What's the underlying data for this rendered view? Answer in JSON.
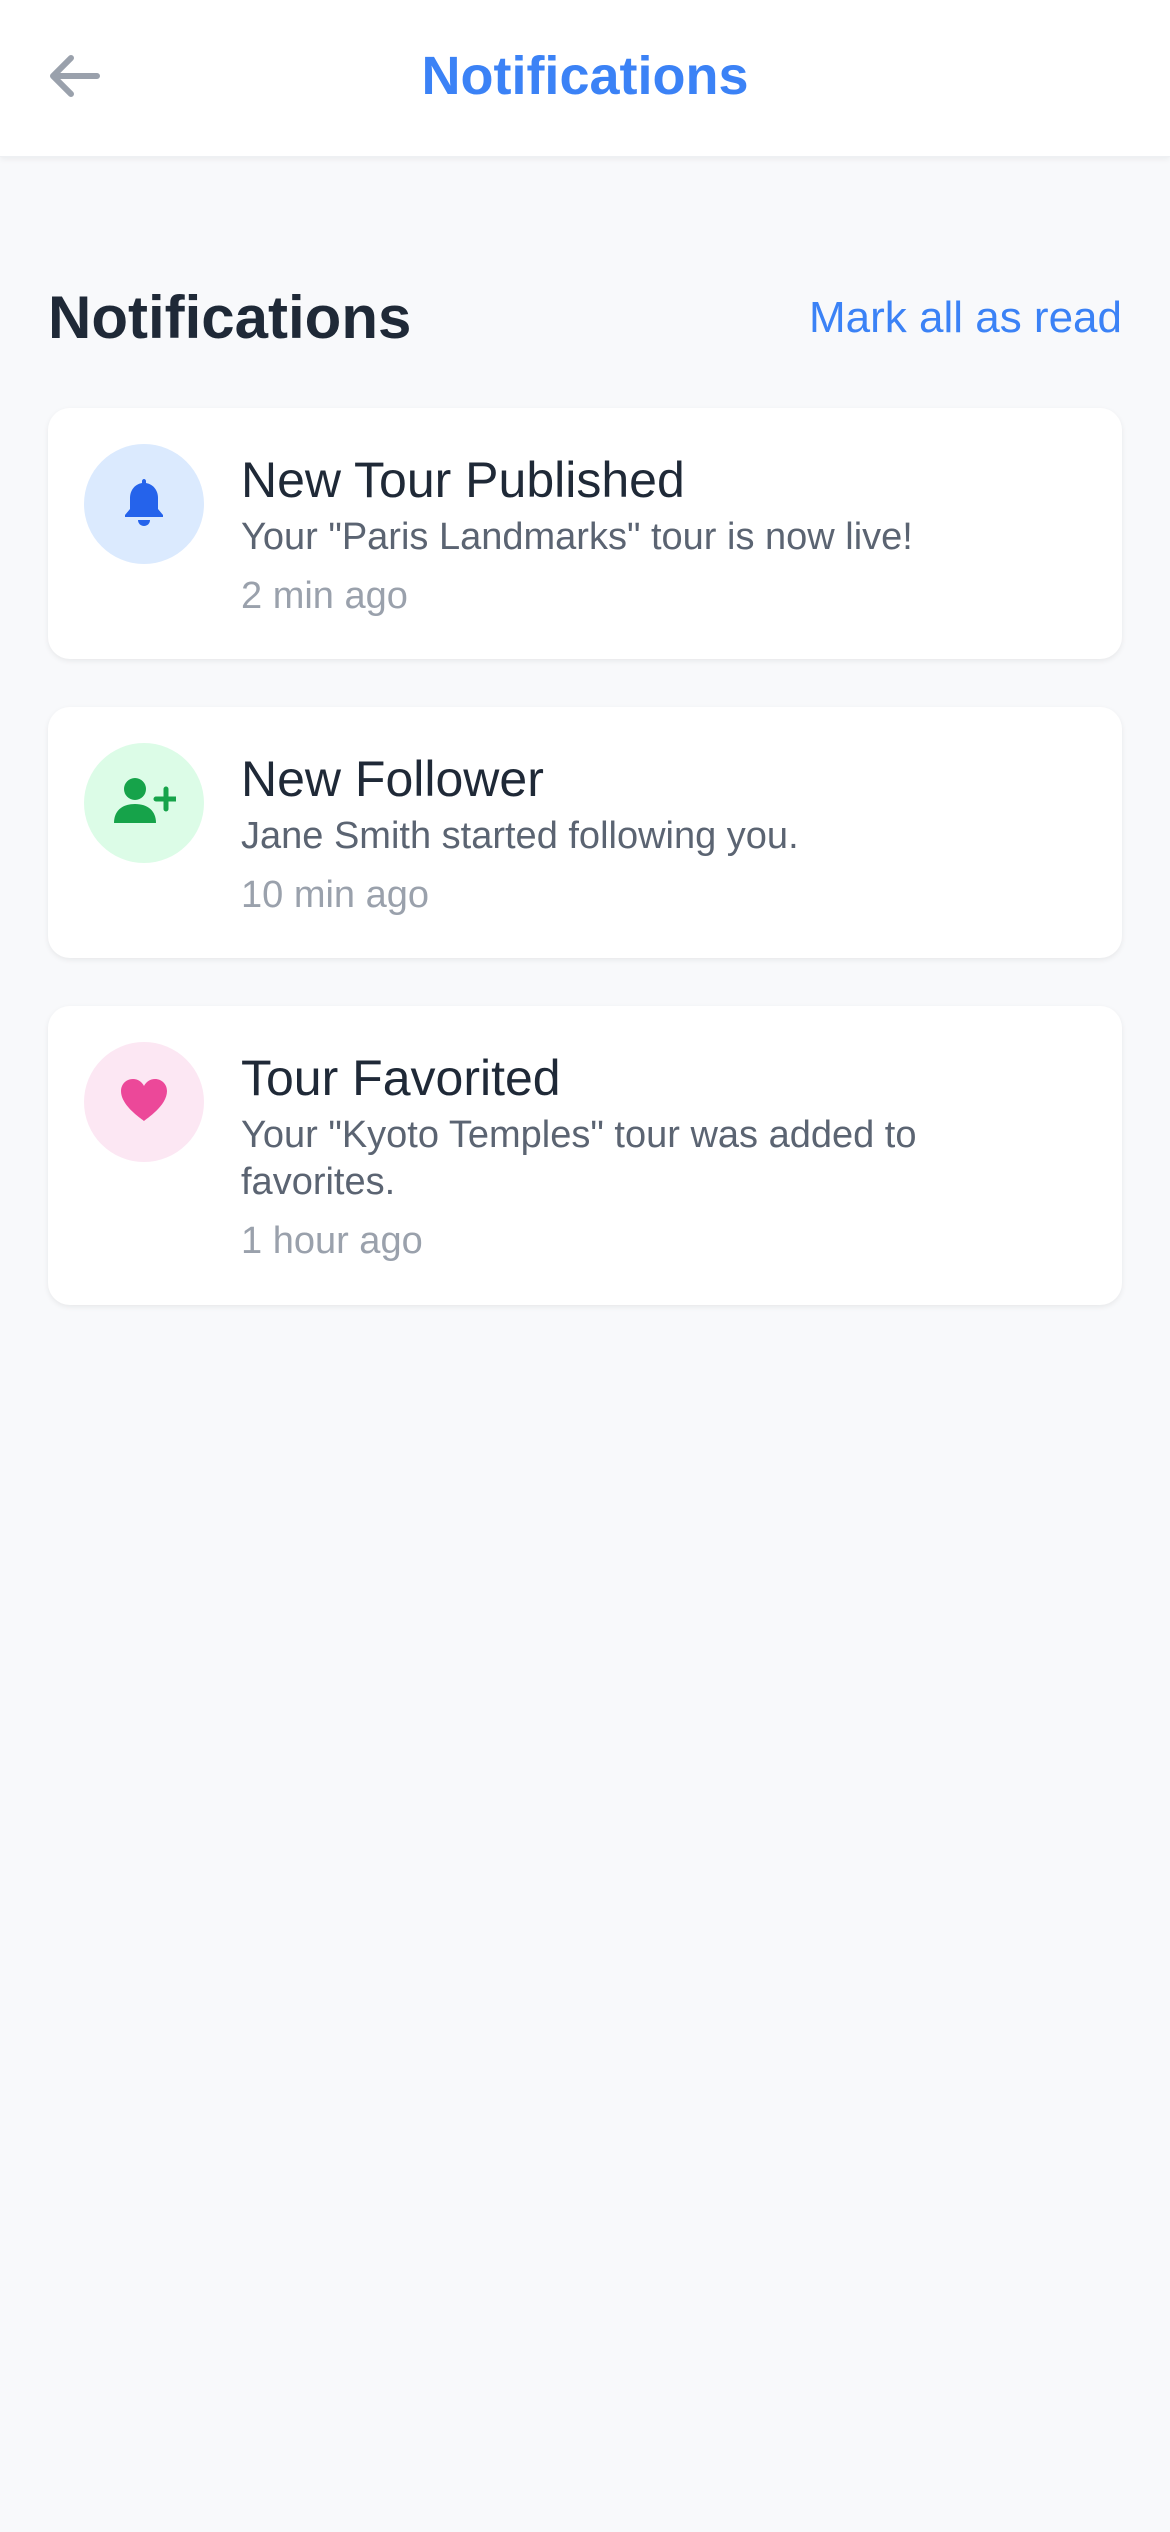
{
  "header": {
    "title": "Notifications",
    "back_icon": "arrow-left-icon"
  },
  "section": {
    "title": "Notifications",
    "mark_all_label": "Mark all as read"
  },
  "notifications": [
    {
      "icon": "bell-icon",
      "icon_color": "#2563eb",
      "icon_bg": "#dbeafe",
      "title": "New Tour Published",
      "body": "Your \"Paris Landmarks\" tour is now live!",
      "time": "2 min ago"
    },
    {
      "icon": "user-plus-icon",
      "icon_color": "#16a34a",
      "icon_bg": "#dcfce7",
      "title": "New Follower",
      "body": "Jane Smith started following you.",
      "time": "10 min ago"
    },
    {
      "icon": "heart-icon",
      "icon_color": "#ec4899",
      "icon_bg": "#fce7f3",
      "title": "Tour Favorited",
      "body": "Your \"Kyoto Temples\" tour was added to favorites.",
      "time": "1 hour ago"
    }
  ],
  "colors": {
    "accent": "#3b82f6",
    "background": "#f8f9fb",
    "card": "#ffffff",
    "text_primary": "#1f2937",
    "text_secondary": "#5b6472",
    "text_muted": "#9aa1ac"
  }
}
